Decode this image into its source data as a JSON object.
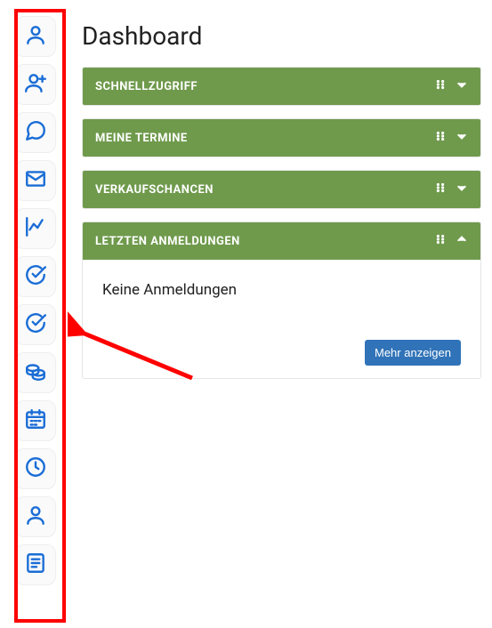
{
  "page": {
    "title": "Dashboard"
  },
  "sidebar": {
    "items": [
      {
        "name": "user-icon"
      },
      {
        "name": "user-plus-icon"
      },
      {
        "name": "chat-icon"
      },
      {
        "name": "mail-icon"
      },
      {
        "name": "insights-icon"
      },
      {
        "name": "check-circle-icon"
      },
      {
        "name": "check-circle-alt-icon"
      },
      {
        "name": "coins-icon"
      },
      {
        "name": "calendar-icon"
      },
      {
        "name": "clock-icon"
      },
      {
        "name": "profile-icon"
      },
      {
        "name": "note-icon"
      }
    ]
  },
  "panels": [
    {
      "title": "SCHNELLZUGRIFF",
      "expanded": false
    },
    {
      "title": "MEINE TERMINE",
      "expanded": false
    },
    {
      "title": "VERKAUFSCHANCEN",
      "expanded": false
    },
    {
      "title": "LETZTEN ANMELDUNGEN",
      "expanded": true,
      "empty_text": "Keine Anmeldungen",
      "more_label": "Mehr anzeigen"
    }
  ]
}
